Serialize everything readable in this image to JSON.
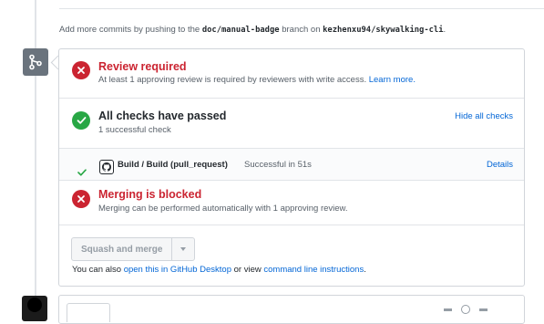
{
  "push_hint": {
    "prefix": "Add more commits by pushing to the ",
    "branch": "doc/manual-badge",
    "middle": " branch on ",
    "repo": "kezhenxu94/skywalking-cli",
    "suffix": "."
  },
  "review": {
    "title": "Review required",
    "description": "At least 1 approving review is required by reviewers with write access.",
    "learn_more": "Learn more."
  },
  "checks": {
    "title": "All checks have passed",
    "subtitle": "1 successful check",
    "hide_all": "Hide all checks",
    "items": [
      {
        "name": "Build / Build (pull_request)",
        "status": "Successful in 51s",
        "details": "Details"
      }
    ]
  },
  "merge_block": {
    "title": "Merging is blocked",
    "description": "Merging can be performed automatically with 1 approving review."
  },
  "merge_action": {
    "button_label": "Squash and merge",
    "also_prefix": "You can also ",
    "desktop_link": "open this in GitHub Desktop",
    "also_middle": " or view ",
    "cli_link": "command line instructions",
    "also_suffix": "."
  },
  "colors": {
    "error_red": "#cb2431",
    "success_green": "#28a745",
    "link_blue": "#0366d6",
    "muted_grey": "#586069"
  },
  "icons": {
    "timeline_badge": "git-merge-icon",
    "review_status": "x-circle-icon",
    "checks_status": "check-circle-icon",
    "check_row": "check-icon",
    "check_avatar": "github-logo-icon",
    "merge_status": "x-circle-icon",
    "merge_dropdown": "caret-down-icon"
  }
}
